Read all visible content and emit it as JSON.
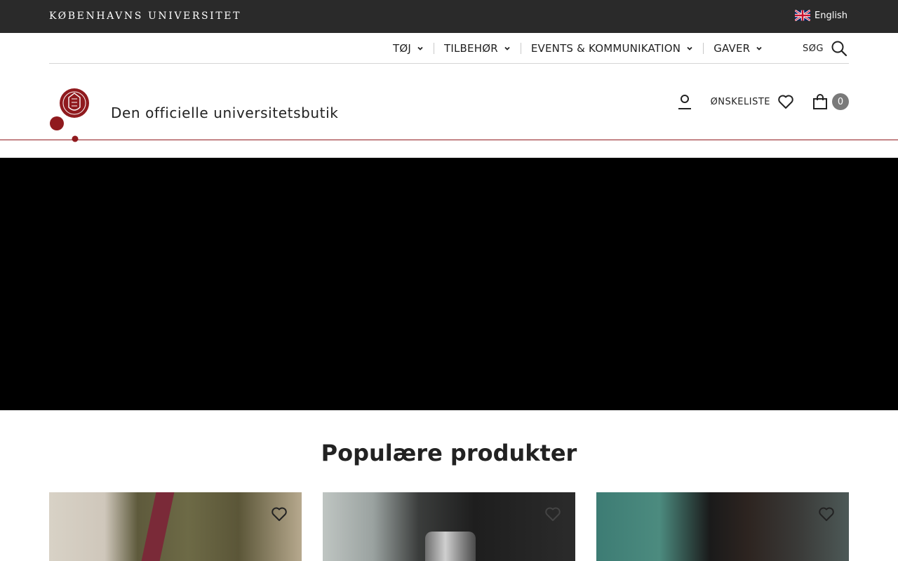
{
  "topbar": {
    "wordmark": "KØBENHAVNS UNIVERSITET",
    "language_label": "English"
  },
  "nav": {
    "items": [
      {
        "label": "TØJ"
      },
      {
        "label": "TILBEHØR"
      },
      {
        "label": "EVENTS & KOMMUNIKATION"
      },
      {
        "label": "GAVER"
      }
    ],
    "search_label": "SØG"
  },
  "header": {
    "tagline": "Den officielle universitetsbutik",
    "wishlist_label": "ØNSKELISTE",
    "cart_count": "0"
  },
  "popular": {
    "title": "Populære produkter"
  },
  "colors": {
    "topbar_bg": "#2a2a2a",
    "brand_red": "#901a1e",
    "hero_bg": "#000000",
    "badge_bg": "#7a7a7a"
  },
  "icons": [
    "uk-flag-icon",
    "chevron-down-icon",
    "search-icon",
    "university-seal-logo",
    "user-icon",
    "heart-icon",
    "shopping-bag-icon"
  ]
}
